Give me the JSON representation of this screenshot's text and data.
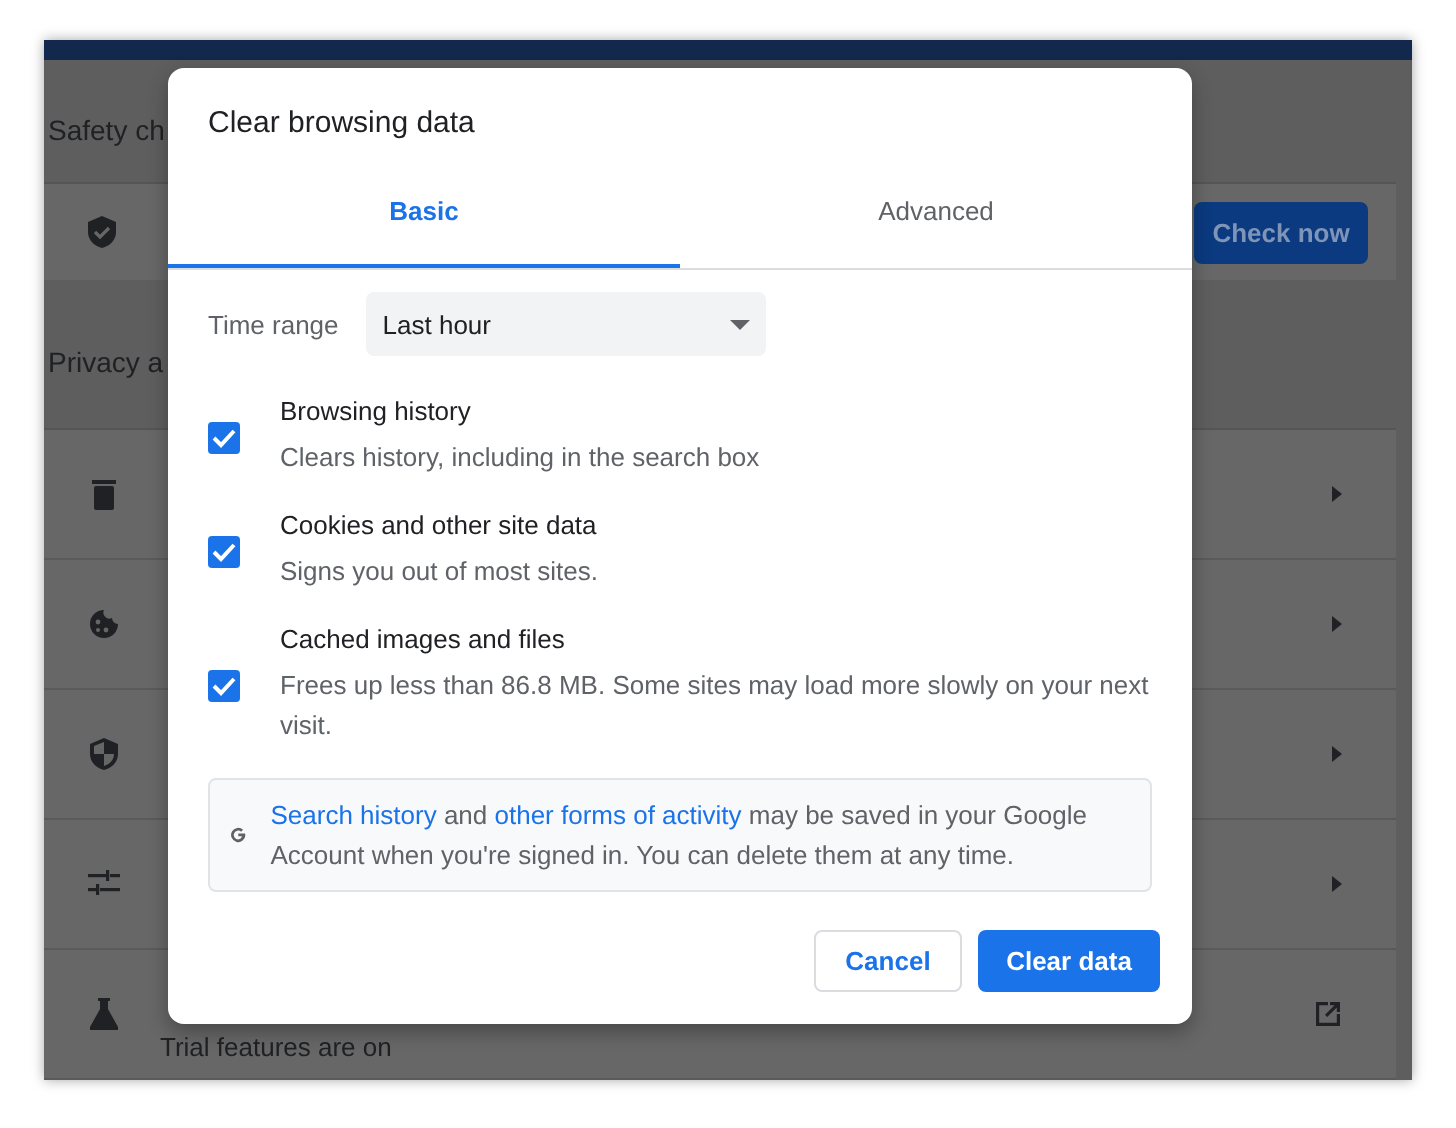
{
  "settings": {
    "safety_heading": "Safety ch",
    "safety_button": "Check now",
    "privacy_heading": "Privacy a",
    "rows": [
      {
        "kind": "arrow"
      },
      {
        "kind": "arrow"
      },
      {
        "kind": "arrow"
      },
      {
        "kind": "arrow"
      },
      {
        "kind": "external",
        "subtitle": "Trial features are on"
      }
    ]
  },
  "dialog": {
    "title": "Clear browsing data",
    "tabs": [
      {
        "label": "Basic",
        "selected": true
      },
      {
        "label": "Advanced",
        "selected": false
      }
    ],
    "time_range": {
      "label": "Time range",
      "value": "Last hour"
    },
    "options": [
      {
        "label": "Browsing history",
        "description": "Clears history, including in the search box",
        "checked": true
      },
      {
        "label": "Cookies and other site data",
        "description": "Signs you out of most sites.",
        "checked": true
      },
      {
        "label": "Cached images and files",
        "description": "Frees up less than 86.8 MB. Some sites may load more slowly on your next visit.",
        "checked": true
      }
    ],
    "notice": [
      {
        "kind": "link",
        "text": "Search history"
      },
      {
        "kind": "text",
        "text": " and "
      },
      {
        "kind": "link",
        "text": "other forms of activity"
      },
      {
        "kind": "text",
        "text": " may be saved in your Google Account when you're signed in. You can delete them at any time."
      }
    ],
    "buttons": [
      {
        "label": "Cancel",
        "kind": "secondary"
      },
      {
        "label": "Clear data",
        "kind": "primary"
      }
    ]
  }
}
